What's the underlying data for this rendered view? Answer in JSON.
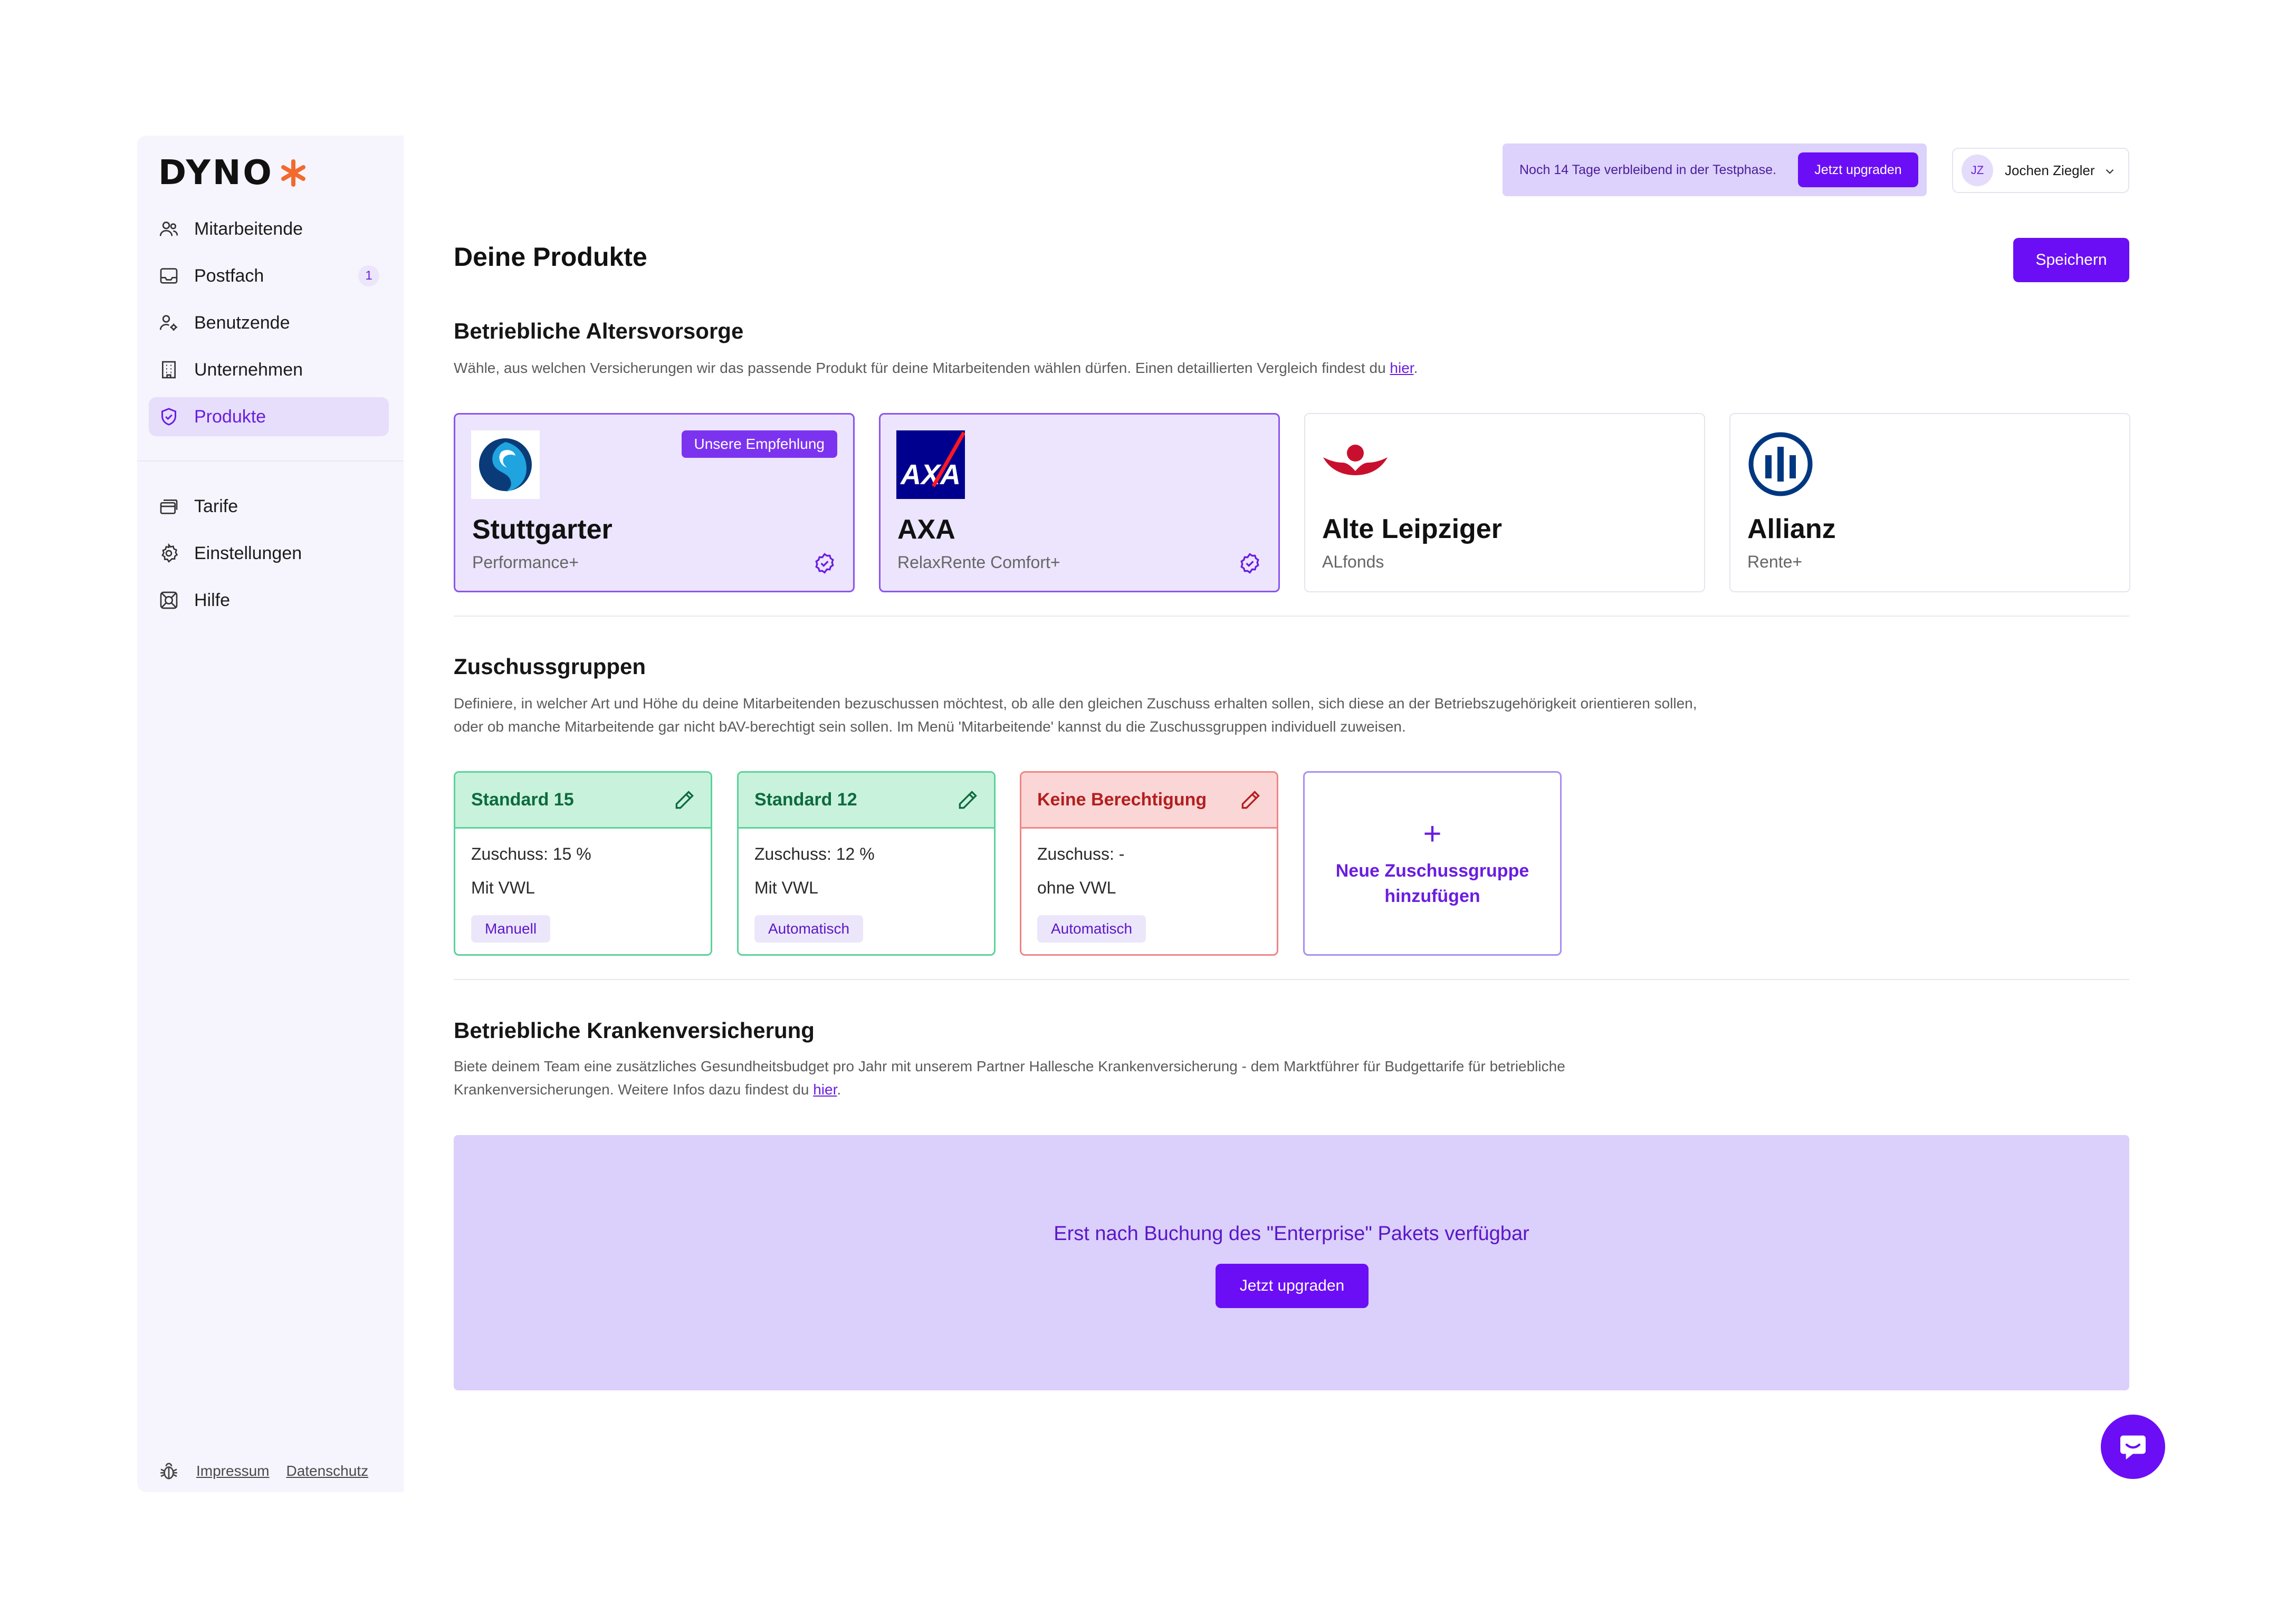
{
  "brand": {
    "name": "DYNO",
    "accent": "#6b0ef5",
    "logo_star_color": "#f26a2e"
  },
  "sidebar": {
    "items": [
      {
        "label": "Mitarbeitende",
        "icon": "users-icon"
      },
      {
        "label": "Postfach",
        "icon": "inbox-icon",
        "badge": "1"
      },
      {
        "label": "Benutzende",
        "icon": "user-settings-icon"
      },
      {
        "label": "Unternehmen",
        "icon": "building-icon"
      },
      {
        "label": "Produkte",
        "icon": "shield-icon",
        "active": true
      }
    ],
    "items2": [
      {
        "label": "Tarife",
        "icon": "cards-icon"
      },
      {
        "label": "Einstellungen",
        "icon": "gear-icon"
      },
      {
        "label": "Hilfe",
        "icon": "lifebuoy-icon"
      }
    ],
    "footer": {
      "impressum": "Impressum",
      "datenschutz": "Datenschutz",
      "icon": "bug-icon"
    }
  },
  "topbar": {
    "trial_text": "Noch 14 Tage verbleibend in der Testphase.",
    "upgrade_label": "Jetzt upgraden",
    "user": {
      "initials": "JZ",
      "name": "Jochen Ziegler"
    }
  },
  "page": {
    "title": "Deine Produkte",
    "save_label": "Speichern"
  },
  "bav": {
    "title": "Betriebliche Altersvorsorge",
    "desc": "Wähle, aus welchen Versicherungen wir das passende Produkt für deine Mitarbeitenden wählen dürfen. Einen detaillierten Vergleich findest du ",
    "link": "hier",
    "desc_end": ".",
    "products": [
      {
        "name": "Stuttgarter",
        "sub": "Performance+",
        "selected": true,
        "recommended": "Unsere Empfehlung"
      },
      {
        "name": "AXA",
        "sub": "RelaxRente Comfort+",
        "selected": true,
        "logo_text": "AXA"
      },
      {
        "name": "Alte Leipziger",
        "sub": "ALfonds",
        "selected": false
      },
      {
        "name": "Allianz",
        "sub": "Rente+",
        "selected": false
      }
    ]
  },
  "zuschuss": {
    "title": "Zuschussgruppen",
    "desc": "Definiere, in welcher Art und Höhe du deine Mitarbeitenden bezuschussen möchtest, ob alle den gleichen Zuschuss erhalten sollen, sich diese an der Betriebszugehörigkeit orientieren sollen, oder ob manche Mitarbeitende gar nicht bAV-berechtigt sein sollen. Im Menü 'Mitarbeitende' kannst du die Zuschussgruppen individuell zuweisen.",
    "groups": [
      {
        "name": "Standard 15",
        "line1": "Zuschuss: 15 %",
        "line2": "Mit VWL",
        "tag": "Manuell",
        "color": "green"
      },
      {
        "name": "Standard 12",
        "line1": "Zuschuss: 12 %",
        "line2": "Mit VWL",
        "tag": "Automatisch",
        "color": "green"
      },
      {
        "name": "Keine Berechtigung",
        "line1": "Zuschuss: -",
        "line2": "ohne VWL",
        "tag": "Automatisch",
        "color": "red"
      }
    ],
    "add_plus": "+",
    "add_label": "Neue Zuschussgruppe hinzufügen"
  },
  "bkv": {
    "title": "Betriebliche Krankenversicherung",
    "desc": "Biete deinem Team eine zusätzliches Gesundheitsbudget pro Jahr mit unserem Partner Hallesche Krankenversicherung - dem Marktführer für Budgettarife für betriebliche Krankenversicherungen. Weitere Infos dazu findest du ",
    "link": "hier",
    "desc_end": ".",
    "enterprise_text": "Erst nach Buchung des \"Enterprise\" Pakets verfügbar",
    "upgrade_label": "Jetzt upgraden"
  },
  "chat": {
    "icon": "chat-icon"
  }
}
